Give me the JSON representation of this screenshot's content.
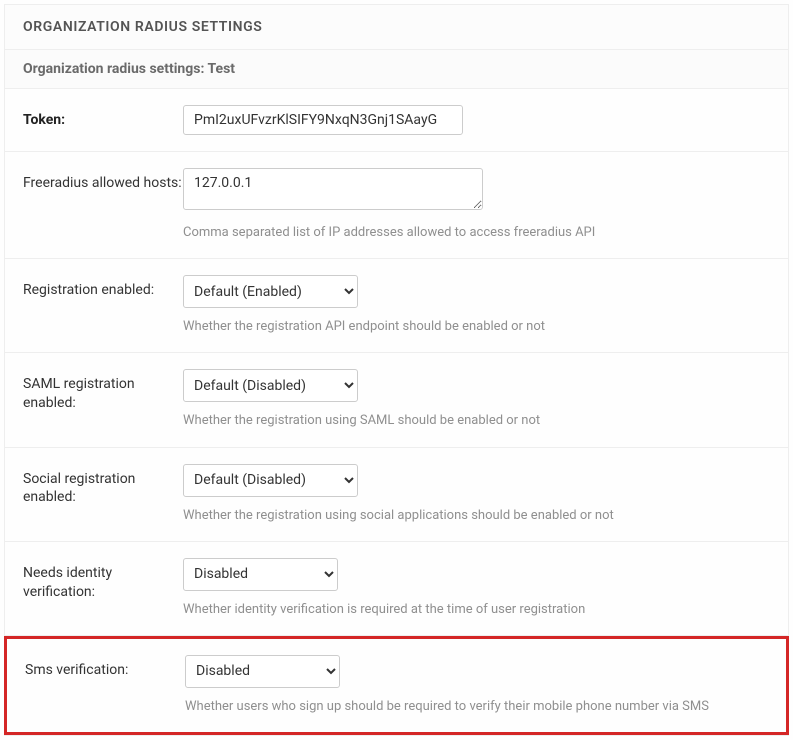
{
  "panel": {
    "title": "ORGANIZATION RADIUS SETTINGS",
    "subtitle": "Organization radius settings: Test"
  },
  "fields": {
    "token": {
      "label": "Token:",
      "value": "PmI2uxUFvzrKlSIFY9NxqN3Gnj1SAayG"
    },
    "freeradius": {
      "label": "Freeradius allowed hosts:",
      "value": "127.0.0.1",
      "help": "Comma separated list of IP addresses allowed to access freeradius API"
    },
    "registration": {
      "label": "Registration enabled:",
      "value": "Default (Enabled)",
      "help": "Whether the registration API endpoint should be enabled or not"
    },
    "saml": {
      "label": "SAML registration enabled:",
      "value": "Default (Disabled)",
      "help": "Whether the registration using SAML should be enabled or not"
    },
    "social": {
      "label": "Social registration enabled:",
      "value": "Default (Disabled)",
      "help": "Whether the registration using social applications should be enabled or not"
    },
    "identity": {
      "label": "Needs identity verification:",
      "value": "Disabled",
      "help": "Whether identity verification is required at the time of user registration"
    },
    "sms": {
      "label": "Sms verification:",
      "value": "Disabled",
      "help": "Whether users who sign up should be required to verify their mobile phone number via SMS"
    }
  }
}
